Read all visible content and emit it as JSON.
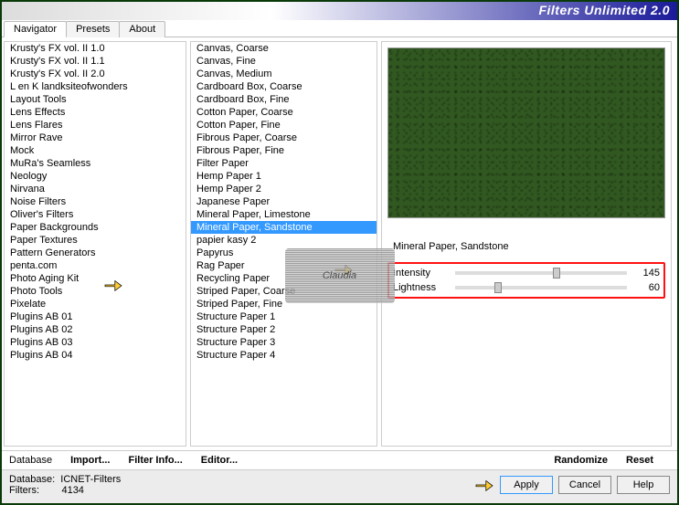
{
  "title": "Filters Unlimited 2.0",
  "tabs": {
    "t0": "Navigator",
    "t1": "Presets",
    "t2": "About"
  },
  "categories": [
    "Krusty's FX vol. II 1.0",
    "Krusty's FX vol. II 1.1",
    "Krusty's FX vol. II 2.0",
    "L en K landksiteofwonders",
    "Layout Tools",
    "Lens Effects",
    "Lens Flares",
    "Mirror Rave",
    "Mock",
    "MuRa's Seamless",
    "Neology",
    "Nirvana",
    "Noise Filters",
    "Oliver's Filters",
    "Paper Backgrounds",
    "Paper Textures",
    "Pattern Generators",
    "penta.com",
    "Photo Aging Kit",
    "Photo Tools",
    "Pixelate",
    "Plugins AB 01",
    "Plugins AB 02",
    "Plugins AB 03",
    "Plugins AB 04"
  ],
  "filters": [
    "Canvas, Coarse",
    "Canvas, Fine",
    "Canvas, Medium",
    "Cardboard Box, Coarse",
    "Cardboard Box, Fine",
    "Cotton Paper, Coarse",
    "Cotton Paper, Fine",
    "Fibrous Paper, Coarse",
    "Fibrous Paper, Fine",
    "Filter Paper",
    "Hemp Paper 1",
    "Hemp Paper 2",
    "Japanese Paper",
    "Mineral Paper, Limestone",
    "Mineral Paper, Sandstone",
    "papier kasy 2",
    "Papyrus",
    "Rag Paper",
    "Recycling Paper",
    "Striped Paper, Coarse",
    "Striped Paper, Fine",
    "Structure Paper 1",
    "Structure Paper 2",
    "Structure Paper 3",
    "Structure Paper 4"
  ],
  "selected_filter": "Mineral Paper, Sandstone",
  "watermark": "Claudia",
  "params": {
    "p0": {
      "label": "Intensity",
      "value": "145"
    },
    "p1": {
      "label": "Lightness",
      "value": "60"
    }
  },
  "linkbtns": {
    "database": "Database",
    "import": "Import...",
    "filterinfo": "Filter Info...",
    "editor": "Editor...",
    "randomize": "Randomize",
    "reset": "Reset"
  },
  "footer": {
    "db_label": "Database:",
    "db_value": "ICNET-Filters",
    "filters_label": "Filters:",
    "filters_value": "4134",
    "apply": "Apply",
    "cancel": "Cancel",
    "help": "Help"
  }
}
